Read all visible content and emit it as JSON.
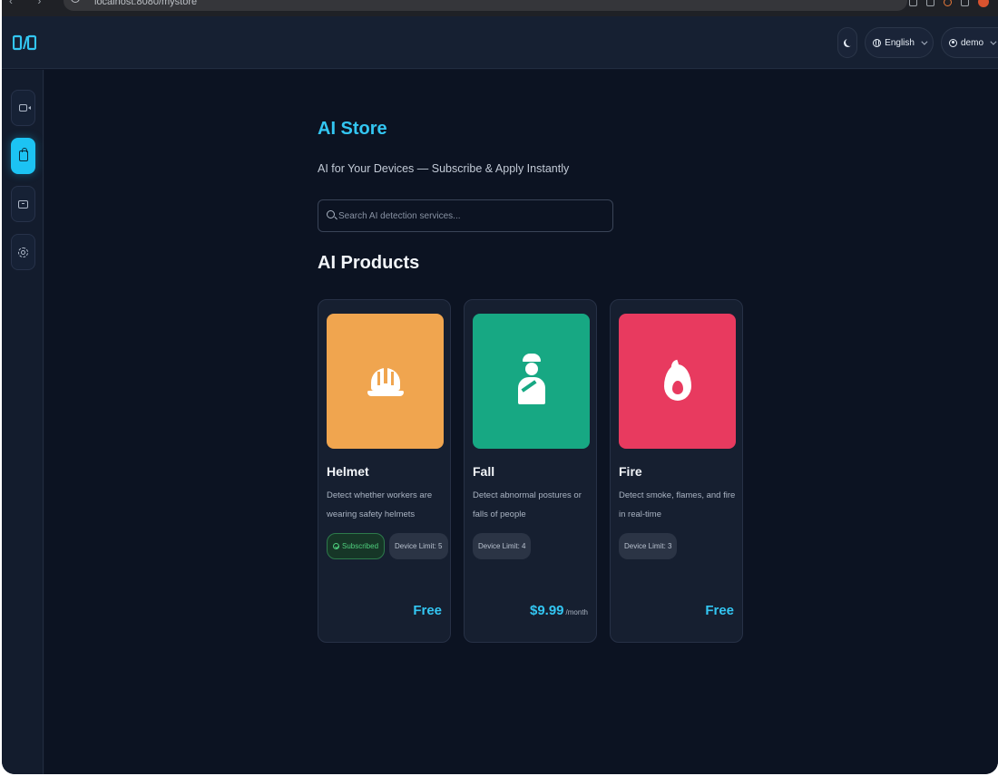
{
  "browser": {
    "url": "localhost:8080/mystore"
  },
  "header": {
    "language": "English",
    "user": "demo"
  },
  "sidebar": {
    "items": [
      {
        "icon": "video-camera-icon",
        "active": false
      },
      {
        "icon": "shopping-bag-icon",
        "active": true
      },
      {
        "icon": "ticket-icon",
        "active": false
      },
      {
        "icon": "settings-gear-icon",
        "active": false
      }
    ]
  },
  "page": {
    "title": "AI Store",
    "subtitle": "AI for Your Devices — Subscribe & Apply Instantly",
    "search_placeholder": "Search AI detection services...",
    "section_title": "AI Products"
  },
  "colors": {
    "accent": "#33c6f2",
    "helmet_bg": "#f0a54f",
    "fall_bg": "#17a883",
    "fire_bg": "#e83a5f",
    "subscribed_green": "#4fd07e"
  },
  "products": [
    {
      "name": "Helmet",
      "description": "Detect whether workers are wearing safety helmets",
      "subscribed_label": "Subscribed",
      "device_limit": "Device Limit: 5",
      "price": "Free",
      "price_unit": "",
      "icon": "safety-helmet-icon"
    },
    {
      "name": "Fall",
      "description": "Detect abnormal postures or falls of people",
      "subscribed_label": "",
      "device_limit": "Device Limit: 4",
      "price": "$9.99",
      "price_unit": "/month",
      "icon": "injured-person-icon"
    },
    {
      "name": "Fire",
      "description": "Detect smoke, flames, and fire in real-time",
      "subscribed_label": "",
      "device_limit": "Device Limit: 3",
      "price": "Free",
      "price_unit": "",
      "icon": "fire-flame-icon"
    }
  ]
}
